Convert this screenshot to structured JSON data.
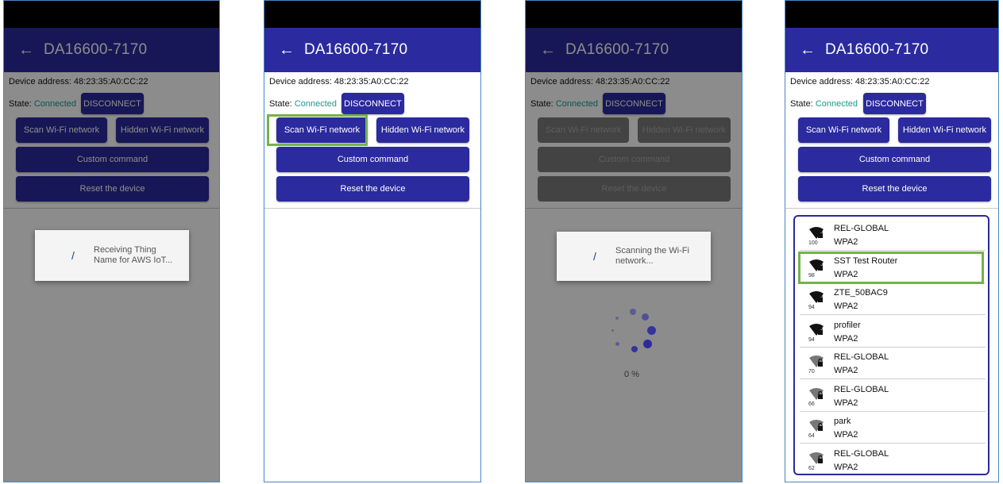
{
  "app": {
    "title": "DA16600-7170",
    "back_glyph": "←",
    "device_address_label": "Device address: 48:23:35:A0:CC:22",
    "state_label": "State:",
    "state_value": "Connected",
    "disconnect": "DISCONNECT",
    "scan_wifi": "Scan Wi-Fi network",
    "hidden_wifi": "Hidden Wi-Fi network",
    "custom_command": "Custom command",
    "reset_device": "Reset the device"
  },
  "panels": {
    "p1": {
      "dialog_text_line1": "Receiving Thing",
      "dialog_text_line2": "Name for AWS IoT..."
    },
    "p3": {
      "dialog_text_line1": "Scanning the Wi-Fi",
      "dialog_text_line2": "network...",
      "progress": "0  %"
    }
  },
  "wifi_networks": [
    {
      "ssid": "REL-GLOBAL",
      "security": "WPA2",
      "rssi": "100"
    },
    {
      "ssid": "SST Test Router",
      "security": "WPA2",
      "rssi": "98"
    },
    {
      "ssid": "ZTE_50BAC9",
      "security": "WPA2",
      "rssi": "94"
    },
    {
      "ssid": "profiler",
      "security": "WPA2",
      "rssi": "94"
    },
    {
      "ssid": "REL-GLOBAL",
      "security": "WPA2",
      "rssi": "70"
    },
    {
      "ssid": "REL-GLOBAL",
      "security": "WPA2",
      "rssi": "66"
    },
    {
      "ssid": "park",
      "security": "WPA2",
      "rssi": "64"
    },
    {
      "ssid": "REL-GLOBAL",
      "security": "WPA2",
      "rssi": "62"
    }
  ],
  "colors": {
    "primary": "#2b2a9e",
    "connected": "#1c9a8c",
    "highlight": "#74b24a",
    "frame": "#4a86c5"
  },
  "icons": {
    "wifi": "wifi-lock-icon",
    "spinner": "progress-spinner-icon"
  }
}
